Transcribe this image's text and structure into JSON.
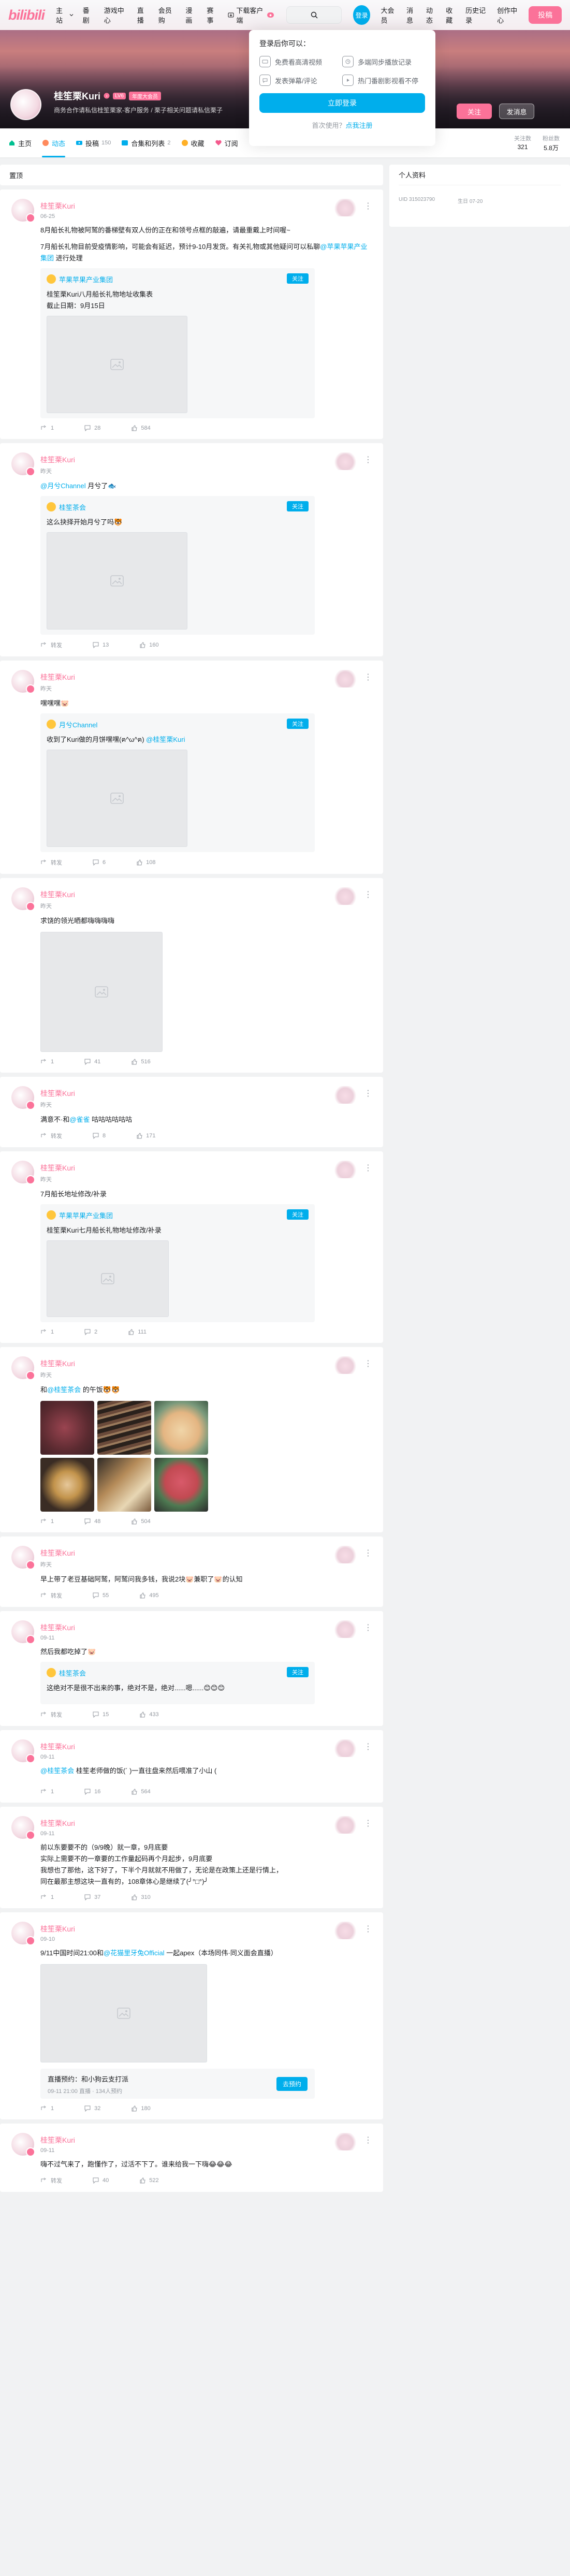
{
  "nav": {
    "logo": "bilibili",
    "links": [
      "主站",
      "番剧",
      "游戏中心",
      "直播",
      "会员购",
      "漫画",
      "赛事",
      "下载客户端"
    ],
    "download_badge": "",
    "login_avatar": "登录",
    "right_links": [
      "大会员",
      "消息",
      "动态",
      "收藏",
      "历史记录",
      "创作中心"
    ],
    "upload": "投稿"
  },
  "login_popup": {
    "title": "登录后你可以：",
    "features": [
      "免费看高清视频",
      "多端同步播放记录",
      "发表弹幕/评论",
      "热门番剧影视看不停"
    ],
    "button": "立即登录",
    "register_prefix": "首次使用？",
    "register_link": "点我注册"
  },
  "profile": {
    "name": "桂笙栗Kuri",
    "level": "LV6",
    "vip": "年度大会员",
    "sign": "商务合作请私信桂笙栗家-客户服务 / 栗子相关问题请私信栗子",
    "follow": "关注",
    "message": "发消息"
  },
  "tabs": [
    {
      "label": "主页",
      "count": ""
    },
    {
      "label": "动态",
      "count": ""
    },
    {
      "label": "投稿",
      "count": "150"
    },
    {
      "label": "合集和列表",
      "count": "2"
    },
    {
      "label": "收藏",
      "count": ""
    },
    {
      "label": "订阅",
      "count": ""
    }
  ],
  "stats": [
    {
      "label": "关注数",
      "value": "321"
    },
    {
      "label": "粉丝数",
      "value": "5.8万"
    }
  ],
  "dynamics_header": "置顶",
  "right": {
    "title": "个人资料",
    "uid": "UID 315023790",
    "birthday": "生日 07-20"
  },
  "posts": [
    {
      "name": "桂笙栗Kuri",
      "time": "06-25",
      "text": "8月船长礼物被阿鹫的番梯壁有双人份的正在和领号点框的敲遍，请最重戴上时间喔~",
      "text2": "7月船长礼物目前受疫情影响，可能会有延迟，预计9-10月发货。有关礼物或其他疑问可以私聊@苹果苹果产业集团 进行处理",
      "fwd_name": "苹果苹果产业集团",
      "fwd_text": "桂笙栗Kuri八月船长礼物地址收集表\n截止日期：9月15日",
      "fwd_btn": "关注",
      "stats": [
        "1",
        "28",
        "584"
      ]
    },
    {
      "name": "桂笙栗Kuri",
      "time": "昨天",
      "text": "@月兮Channel 月兮了🐟",
      "fwd_name": "桂笙茶会",
      "fwd_text": "这么抉择开始月兮了吗🐯",
      "fwd_btn": "关注",
      "stats": [
        "转发",
        "13",
        "160"
      ]
    },
    {
      "name": "桂笙栗Kuri",
      "time": "昨天",
      "text": "嘿嘿嘿🐷",
      "fwd_name": "月兮Channel",
      "fwd_text": "收到了Kuri做的月饼嘿嘿(ฅ^ω^ฅ) @桂笙栗Kuri",
      "fwd_btn": "关注",
      "stats": [
        "转发",
        "6",
        "108"
      ]
    },
    {
      "name": "桂笙栗Kuri",
      "time": "昨天",
      "text": "求饶的领光晒都嗨嗨嗨嗨",
      "stats": [
        "1",
        "41",
        "516"
      ]
    },
    {
      "name": "桂笙栗Kuri",
      "time": "昨天",
      "text": "满意不·和@雀雀 咕咕咕咕咕咕",
      "stats": [
        "转发",
        "8",
        "171"
      ]
    },
    {
      "name": "桂笙栗Kuri",
      "time": "昨天",
      "text": "7月船长地址修改/补录",
      "fwd_name": "苹果苹果产业集团",
      "fwd_text": "桂笙栗Kuri七月船长礼物地址修改/补录",
      "fwd_btn": "关注",
      "stats": [
        "1",
        "2",
        "111"
      ]
    },
    {
      "name": "桂笙栗Kuri",
      "time": "昨天",
      "text": "和@桂笙茶会 的午饭🐯🐯",
      "stats": [
        "1",
        "48",
        "504"
      ]
    },
    {
      "name": "桂笙栗Kuri",
      "time": "昨天",
      "text": "早上带了老豆基础阿鹫，阿鹫问我多钱，我说2块🐷兼职了🐷的认知",
      "stats": [
        "转发",
        "55",
        "495"
      ]
    },
    {
      "name": "桂笙栗Kuri",
      "time": "09-11",
      "text": "然后我都吃掉了🐷",
      "fwd_name": "桂笙茶会",
      "fwd_text": "这绝对不是很不出来的事，绝对不是，绝对......嗯......😊😊😊",
      "fwd_btn": "关注",
      "stats": [
        "转发",
        "15",
        "433"
      ]
    },
    {
      "name": "桂笙栗Kuri",
      "time": "09-11",
      "text": "@桂笙茶会 桂笙老师做的饭(´ )一直往盘来然后喂准了小山 (",
      "stats": [
        "1",
        "16",
        "564"
      ]
    },
    {
      "name": "桂笙栗Kuri",
      "time": "09-11",
      "text": "前以东要要不的（9/9晚）就一章，9月底要\n实际上需要不的一章要的工作量起码再个月起步，9月底要\n我想也了那他，这下好了，下半个月就就不用做了，无论是在政策上还是行情上，\n同在最那主想这块一直有的，108章体心是继续了(╯°□°)╯",
      "stats": [
        "1",
        "37",
        "310"
      ]
    },
    {
      "name": "桂笙栗Kuri",
      "time": "09-10",
      "text": "9/11中国时间21:00和@花猫里牙兔Official 一起apex（本场同伟·同义面会直播）",
      "live_title": "直播预约：和小狗云支打派",
      "live_sub": "09-11 21:00 直播 · 134人预约",
      "live_btn": "去预约",
      "stats": [
        "1",
        "32",
        "180"
      ]
    },
    {
      "name": "桂笙栗Kuri",
      "time": "09-11",
      "text": "嗨不过气来了，跑懂作了，过活不下了。谁来给我一下嗨😂😂😂",
      "stats": [
        "转发",
        "40",
        "522"
      ]
    }
  ]
}
